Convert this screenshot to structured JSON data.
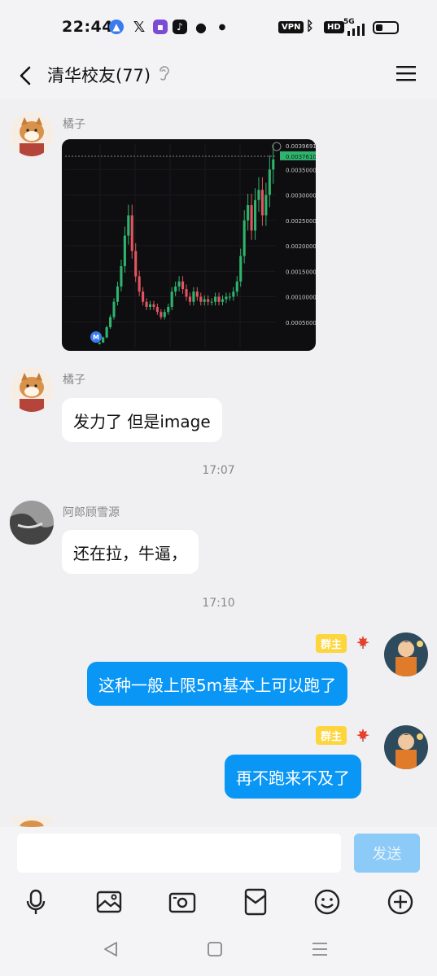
{
  "status_bar": {
    "time": "22:44",
    "vpn": "VPN",
    "hd": "HD",
    "network": "5G",
    "battery_level": 0.35,
    "icons": [
      "app-icon",
      "x-icon",
      "app-icon",
      "tiktok-icon",
      "wechat-icon",
      "dot-icon",
      "vpn-icon",
      "bluetooth-icon",
      "hd-icon",
      "signal-icon",
      "battery-icon"
    ]
  },
  "header": {
    "title": "清华校友(77)",
    "icons": [
      "back-icon",
      "ear-icon",
      "menu-icon"
    ]
  },
  "messages": [
    {
      "sender": "橘子",
      "type": "image"
    },
    {
      "sender": "橘子",
      "text": "发力了 但是image"
    },
    {
      "timestamp": "17:07"
    },
    {
      "sender": "阿郎顾雪源",
      "text": "还在拉，牛逼，"
    },
    {
      "timestamp": "17:10"
    },
    {
      "sender_badge": "群主",
      "text": "这种一般上限5m基本上可以跑了"
    },
    {
      "sender_badge": "群主",
      "text": "再不跑来不及了"
    },
    {
      "sender": "橘子",
      "partial": true
    }
  ],
  "chart_data": {
    "type": "line",
    "subtype": "candlestick",
    "price_labels": [
      "0.0039691",
      "0.0037610",
      "0.0035000",
      "0.0030000",
      "0.0025000",
      "0.0020000",
      "0.0015000",
      "0.0010000",
      "0.00050000"
    ],
    "current_price": "0.0037610",
    "marker": "M",
    "yticks": [
      0.0005,
      0.001,
      0.0015,
      0.002,
      0.0025,
      0.003,
      0.0035
    ],
    "ylim": [
      0.0,
      0.004
    ],
    "series": [
      {
        "values": [
          0.0001,
          0.0002,
          0.0004,
          0.0006,
          0.0009,
          0.0012,
          0.0016,
          0.0022,
          0.0026,
          0.0019,
          0.0014,
          0.0011,
          0.0009,
          0.0008,
          0.00085,
          0.0008,
          0.0007,
          0.0006,
          0.0007,
          0.0008,
          0.0011,
          0.0012,
          0.0013,
          0.00115,
          0.001,
          0.0009,
          0.0011,
          0.001,
          0.0009,
          0.00095,
          0.0009,
          0.0009,
          0.001,
          0.0009,
          0.00095,
          0.001,
          0.001,
          0.0011,
          0.0013,
          0.0018,
          0.0025,
          0.0028,
          0.0023,
          0.0029,
          0.0031,
          0.0026,
          0.003,
          0.0035,
          0.0037
        ]
      }
    ],
    "up_color": "#2fb36d",
    "down_color": "#e05561",
    "grid": true
  },
  "input": {
    "value": "",
    "placeholder": "",
    "send_label": "发送"
  },
  "toolbar": [
    "mic-icon",
    "image-icon",
    "camera-icon",
    "red-packet-icon",
    "emoji-icon",
    "plus-icon"
  ],
  "nav": [
    "nav-back-icon",
    "nav-home-icon",
    "nav-menu-icon"
  ],
  "colors": {
    "outgoing_bubble": "#0a96f5",
    "incoming_bubble": "#ffffff",
    "background": "#f0f0f3",
    "owner_badge": "#fdd53c",
    "send_button": "#8ccaf7"
  }
}
